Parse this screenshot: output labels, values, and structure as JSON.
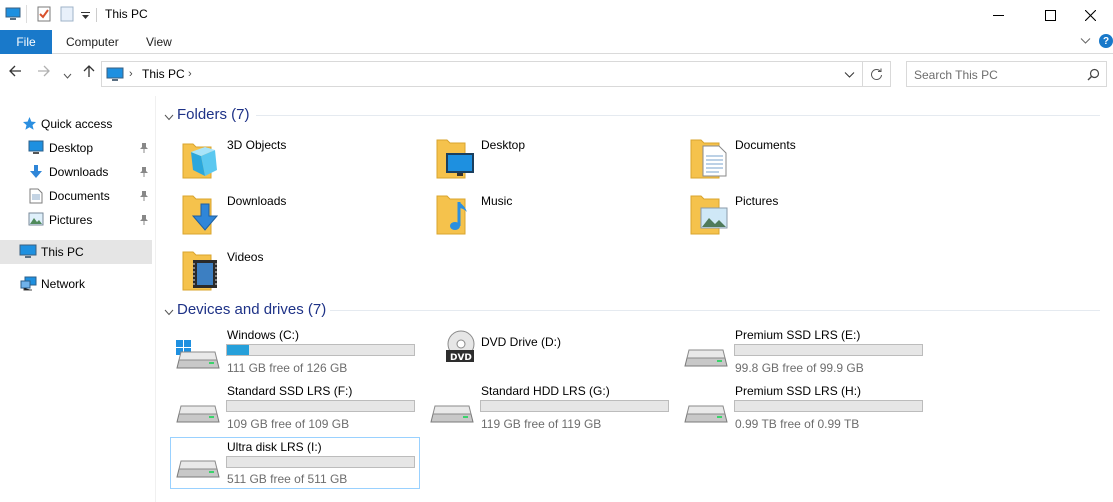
{
  "window": {
    "title": "This PC",
    "minimize_glyph": "—",
    "close_glyph": "✕"
  },
  "ribbon": {
    "file": "File",
    "tabs": [
      "Computer",
      "View"
    ]
  },
  "address": {
    "path_label": "This PC",
    "separator": "›"
  },
  "search": {
    "placeholder": "Search This PC"
  },
  "nav": {
    "quick_access": "Quick access",
    "pinned": [
      {
        "label": "Desktop",
        "icon": "desktop-icon"
      },
      {
        "label": "Downloads",
        "icon": "downloads-icon"
      },
      {
        "label": "Documents",
        "icon": "documents-icon"
      },
      {
        "label": "Pictures",
        "icon": "pictures-icon"
      }
    ],
    "this_pc": "This PC",
    "network": "Network"
  },
  "folders": {
    "header": "Folders (7)",
    "items": [
      {
        "label": "3D Objects",
        "icon": "3d-objects-icon"
      },
      {
        "label": "Desktop",
        "icon": "desktop-icon"
      },
      {
        "label": "Documents",
        "icon": "documents-icon"
      },
      {
        "label": "Downloads",
        "icon": "downloads-icon"
      },
      {
        "label": "Music",
        "icon": "music-icon"
      },
      {
        "label": "Pictures",
        "icon": "pictures-icon"
      },
      {
        "label": "Videos",
        "icon": "videos-icon"
      }
    ]
  },
  "drives": {
    "header": "Devices and drives (7)",
    "items": [
      {
        "label": "Windows (C:)",
        "free": "111 GB free of 126 GB",
        "used_fraction": 0.12,
        "icon": "windows-drive-icon",
        "has_bar": true
      },
      {
        "label": "DVD Drive (D:)",
        "free": "",
        "used_fraction": 0,
        "icon": "dvd-drive-icon",
        "has_bar": false
      },
      {
        "label": "Premium SSD LRS (E:)",
        "free": "99.8 GB free of 99.9 GB",
        "used_fraction": 0.0,
        "icon": "hard-drive-icon",
        "has_bar": true
      },
      {
        "label": "Standard SSD LRS (F:)",
        "free": "109 GB free of 109 GB",
        "used_fraction": 0.0,
        "icon": "hard-drive-icon",
        "has_bar": true
      },
      {
        "label": "Standard HDD LRS (G:)",
        "free": "119 GB free of 119 GB",
        "used_fraction": 0.0,
        "icon": "hard-drive-icon",
        "has_bar": true
      },
      {
        "label": "Premium SSD LRS (H:)",
        "free": "0.99 TB free of 0.99 TB",
        "used_fraction": 0.0,
        "icon": "hard-drive-icon",
        "has_bar": true
      },
      {
        "label": "Ultra disk LRS (I:)",
        "free": "511 GB free of 511 GB",
        "used_fraction": 0.0,
        "icon": "hard-drive-icon",
        "has_bar": true
      }
    ]
  },
  "colors": {
    "accent": "#1979ca",
    "selection": "#e5e5e5",
    "group_title": "#1e3287",
    "usage_bar": "#26a0da"
  }
}
